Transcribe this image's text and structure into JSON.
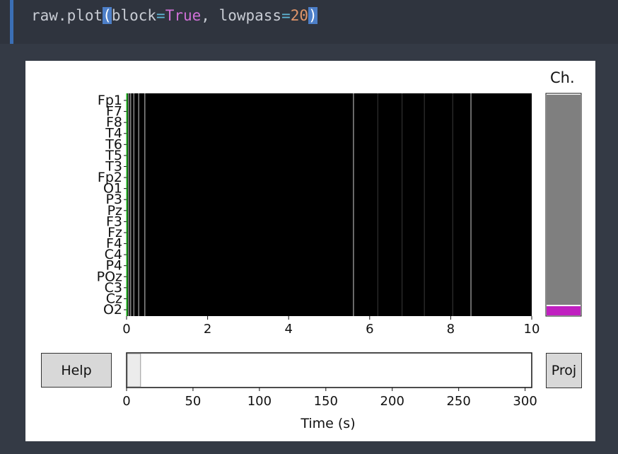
{
  "code": {
    "prefix": "raw.plot",
    "open_paren": "(",
    "arg1_name": "block",
    "eq1": "=",
    "arg1_val": "True",
    "sep": ", ",
    "arg2_name": "lowpass",
    "eq2": "=",
    "arg2_val": "20",
    "close_paren": ")"
  },
  "figure": {
    "channel_panel_title": "Ch.",
    "help_label": "Help",
    "proj_label": "Proj",
    "time_axis_label": "Time (s)",
    "colors": {
      "background": "#000000",
      "trace": "#7a7a7a",
      "scrollbar_thumb": "#7f7f7f",
      "channel_selection": "#c020c0"
    }
  },
  "chart_data": [
    {
      "type": "line",
      "channels": [
        "Fp1",
        "F7",
        "F8",
        "T4",
        "T6",
        "T5",
        "T3",
        "Fp2",
        "O1",
        "P3",
        "Pz",
        "F3",
        "Fz",
        "F4",
        "C4",
        "P4",
        "POz",
        "C3",
        "Cz",
        "O2"
      ],
      "xticks": [
        "0",
        "2",
        "4",
        "6",
        "8",
        "10"
      ],
      "xlim": [
        0,
        10
      ],
      "vertical_transients_s": [
        0.05,
        0.1,
        0.18,
        0.3,
        0.45,
        5.6,
        6.2,
        6.8,
        7.35,
        8.05,
        8.5
      ],
      "xlabel": "",
      "ylabel": ""
    },
    {
      "type": "bar",
      "xticks": [
        "0",
        "50",
        "100",
        "150",
        "200",
        "250",
        "300"
      ],
      "xlim": [
        0,
        305
      ],
      "view_window_s": [
        0,
        10
      ],
      "xlabel": "Time (s)"
    }
  ]
}
